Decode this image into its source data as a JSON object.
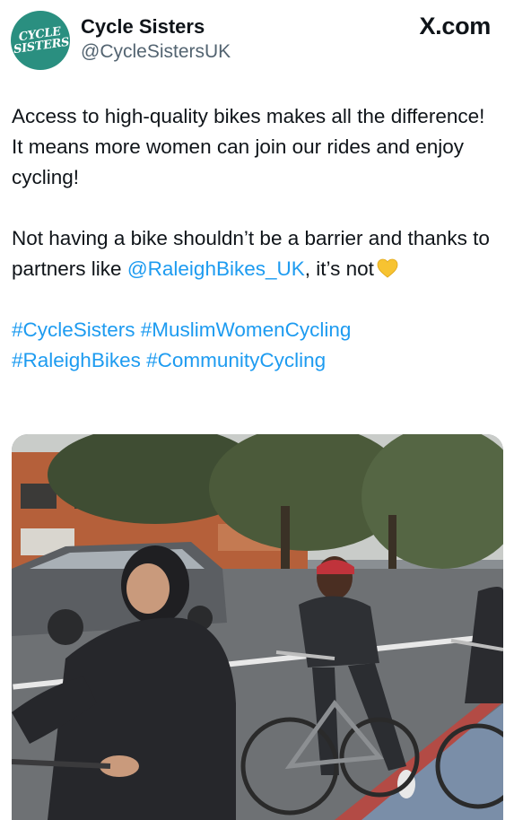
{
  "header": {
    "avatar_text_line1": "CYCLE",
    "avatar_text_line2": "SISTERS",
    "display_name": "Cycle Sisters",
    "handle": "@CycleSistersUK",
    "source_label": "X.com"
  },
  "tweet": {
    "para1": "Access to high-quality bikes makes all the difference! It means more women can join our rides and enjoy cycling!",
    "para2_start": "Not having a bike shouldn’t be a barrier and thanks to partners like ",
    "mention": "@RaleighBikes_UK",
    "para2_end": ", it’s not",
    "heart_emoji": "yellow-heart-icon",
    "hashtags_line1": "#CycleSisters #MuslimWomenCycling",
    "hashtags_line2": "#RaleighBikes #CommunityCycling"
  },
  "media": {
    "description_icon": "video-frame-women-cycling"
  },
  "colors": {
    "link": "#1d9bf0",
    "avatar_bg": "#2a8f80",
    "handle": "#536471",
    "heart": "#f7c331"
  }
}
